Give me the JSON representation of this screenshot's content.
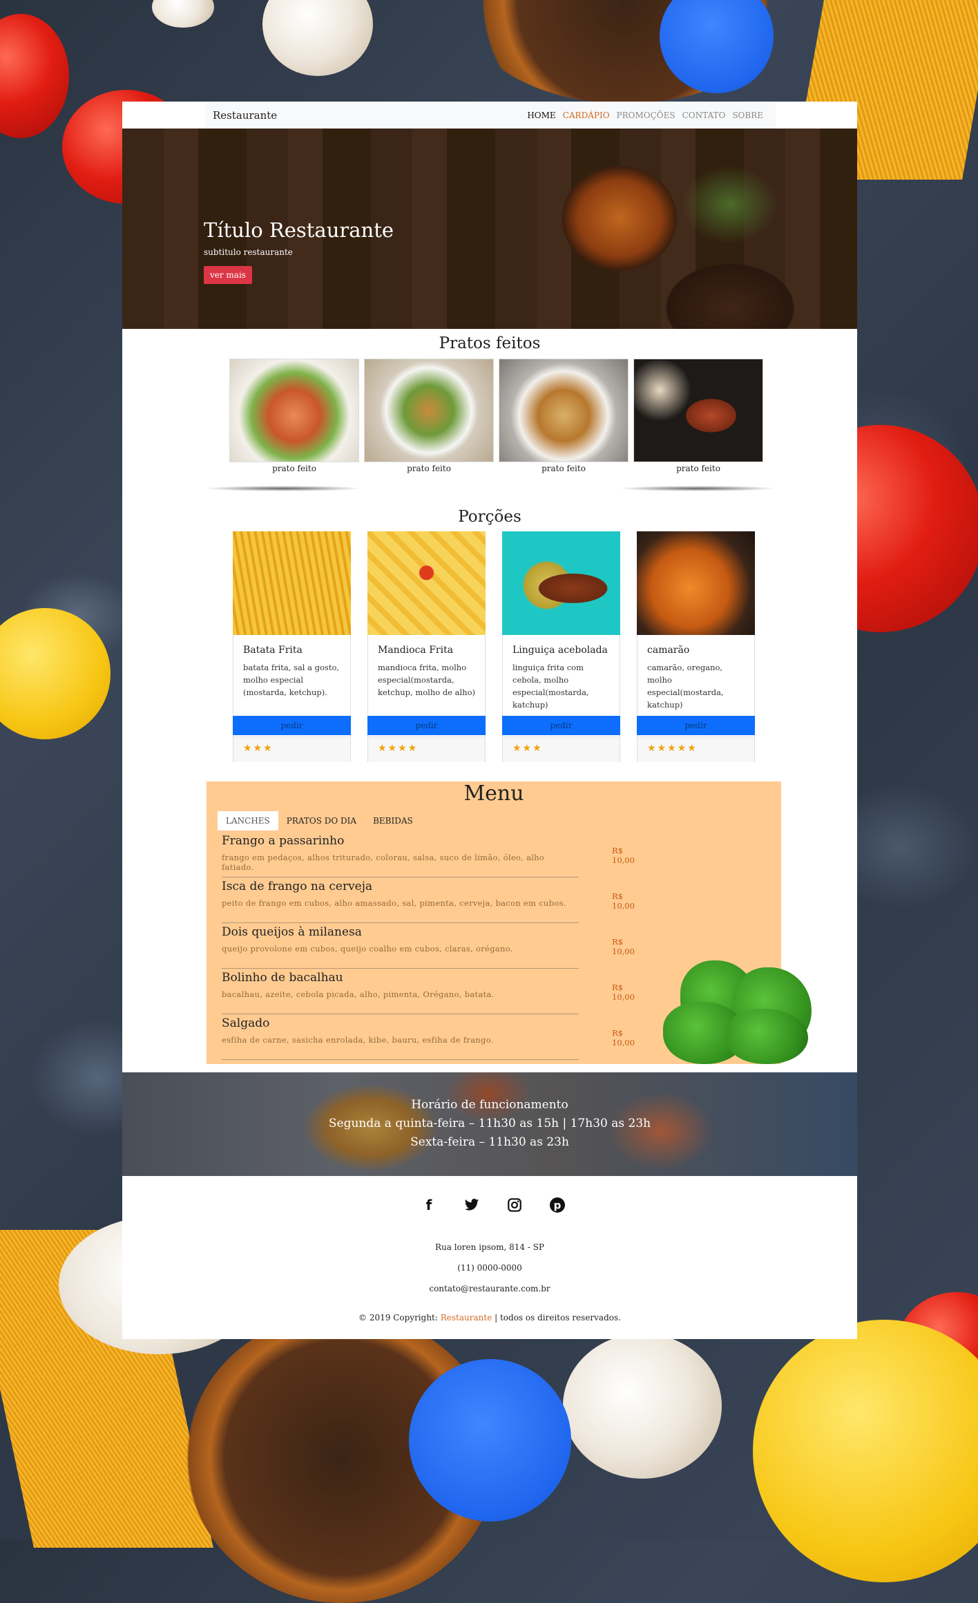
{
  "nav": {
    "brand": "Restaurante",
    "items": [
      "HOME",
      "CARDÁPIO",
      "PROMOÇÕES",
      "CONTATO",
      "SOBRE"
    ]
  },
  "hero": {
    "title": "Título Restaurante",
    "subtitle": "subtitulo restaurante",
    "button": "ver mais"
  },
  "pratos": {
    "title": "Pratos feitos",
    "items": [
      "prato feito",
      "prato feito",
      "prato feito",
      "prato feito"
    ]
  },
  "porcoes": {
    "title": "Porções",
    "cards": [
      {
        "name": "Batata Frita",
        "desc": "batata frita, sal a gosto, molho especial (mostarda, ketchup).",
        "button": "pedir",
        "rating": 3,
        "stars": "★★★"
      },
      {
        "name": "Mandioca Frita",
        "desc": "mandioca frita, molho especial(mostarda, ketchup, molho de alho)",
        "button": "pedir",
        "rating": 4,
        "stars": "★★★★"
      },
      {
        "name": "Linguiça acebolada",
        "desc": "linguiça frita com cebola, molho especial(mostarda, katchup)",
        "button": "pedir",
        "rating": 3,
        "stars": "★★★"
      },
      {
        "name": "camarão",
        "desc": "camarão, oregano, molho especial(mostarda, katchup)",
        "button": "pedir",
        "rating": 5,
        "stars": "★★★★★"
      }
    ]
  },
  "menu": {
    "title": "Menu",
    "tabs": [
      "LANCHES",
      "PRATOS DO DIA",
      "BEBIDAS"
    ],
    "items": [
      {
        "name": "Frango a passarinho",
        "desc": "frango em pedaços, alhos triturado, colorau, salsa, suco de limão, óleo, alho fatiado.",
        "price": "R$ 10,00"
      },
      {
        "name": "Isca de frango na cerveja",
        "desc": "peito de frango em cubos, alho amassado, sal, pimenta, cerveja, bacon em cubos.",
        "price": "R$ 10,00"
      },
      {
        "name": "Dois queijos à milanesa",
        "desc": "queijo provolone em cubos, queijo coalho em cubos, claras, orégano.",
        "price": "R$ 10,00"
      },
      {
        "name": "Bolinho de bacalhau",
        "desc": "bacalhau, azeite, cebola picada, alho, pimenta, Orégano, batata.",
        "price": "R$ 10,00"
      },
      {
        "name": "Salgado",
        "desc": "esfiha de carne, sasicha enrolada, kibe, bauru, esfiha de frango.",
        "price": "R$ 10,00"
      }
    ]
  },
  "horario": {
    "title": "Horário de funcionamento",
    "line1": "Segunda a quinta-feira – 11h30 as 15h | 17h30 as 23h",
    "line2": "Sexta-feira – 11h30 as 23h"
  },
  "footer": {
    "social": [
      "facebook-icon",
      "twitter-icon",
      "instagram-icon",
      "pinterest-icon"
    ],
    "address": "Rua loren ipsom, 814 - SP",
    "phone": "(11) 0000-0000",
    "email": "contato@restaurante.com.br",
    "copyright_prefix": "© 2019 Copyright:",
    "copyright_brand": "Restaurante",
    "copyright_suffix": "| todos os direitos reservados."
  },
  "colors": {
    "accent": "#d2691e",
    "hero_button": "#dc3545",
    "order_button": "#0d6efd",
    "menu_bg": "#ffcb91",
    "stars": "#f0a30a"
  }
}
